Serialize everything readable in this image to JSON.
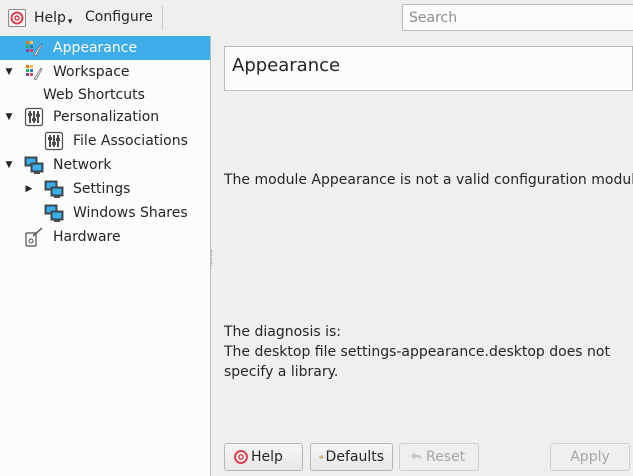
{
  "toolbar": {
    "help_label": "Help",
    "configure_label": "Configure"
  },
  "search": {
    "placeholder": "Search"
  },
  "sidebar": {
    "items": [
      {
        "label": "Appearance",
        "selected": true
      },
      {
        "label": "Workspace",
        "expanded": true
      },
      {
        "label": "Web Shortcuts"
      },
      {
        "label": "Personalization",
        "expanded": true
      },
      {
        "label": "File Associations"
      },
      {
        "label": "Network",
        "expanded": true
      },
      {
        "label": "Settings",
        "expanded": false
      },
      {
        "label": "Windows Shares"
      },
      {
        "label": "Hardware"
      }
    ]
  },
  "main": {
    "title": "Appearance",
    "error_message": "The module Appearance is not a valid configuration module.",
    "diagnosis_label": "The diagnosis is:",
    "diagnosis_line1": "The desktop file settings-appearance.desktop does not",
    "diagnosis_line2": "specify a library."
  },
  "buttons": {
    "help": "Help",
    "defaults": "Defaults",
    "reset": "Reset",
    "apply": "Apply"
  },
  "colors": {
    "selection": "#3daee9",
    "window_bg": "#efefef",
    "view_bg": "#fcfcfc",
    "text": "#232627",
    "disabled_text": "#a5a6a7"
  }
}
